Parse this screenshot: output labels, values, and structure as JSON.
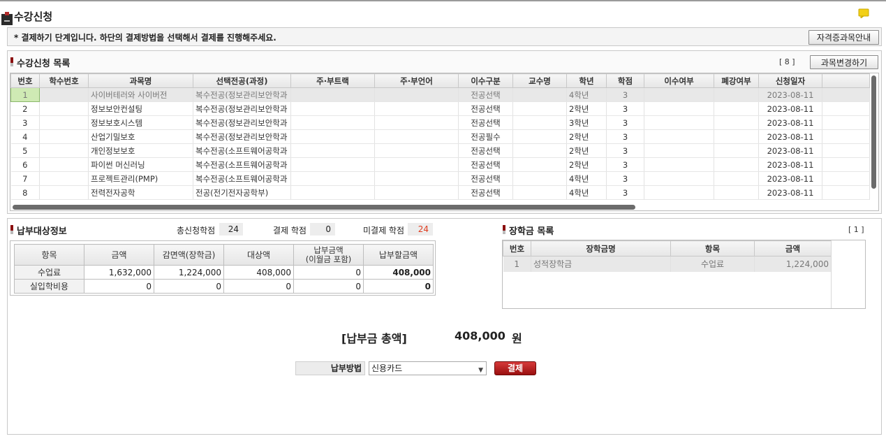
{
  "page": {
    "title": "수강신청",
    "notice": "* 결제하기 단계입니다. 하단의 결제방법을 선택해서 결제를 진행해주세요.",
    "cert_button": "자격증과목안내"
  },
  "course_list": {
    "title": "수강신청 목록",
    "count": "[ 8 ]",
    "change_button": "과목변경하기",
    "columns": [
      "번호",
      "학수번호",
      "과목명",
      "선택전공(과정)",
      "주·부트랙",
      "주·부언어",
      "이수구분",
      "교수명",
      "학년",
      "학점",
      "이수여부",
      "폐강여부",
      "신청일자"
    ],
    "rows": [
      [
        "1",
        "",
        "사이버테러와 사이버전",
        "복수전공(정보관리보안학과",
        "",
        "",
        "전공선택",
        "",
        "4학년",
        "3",
        "",
        "",
        "2023-08-11"
      ],
      [
        "2",
        "",
        "정보보안컨설팅",
        "복수전공(정보관리보안학과",
        "",
        "",
        "전공선택",
        "",
        "2학년",
        "3",
        "",
        "",
        "2023-08-11"
      ],
      [
        "3",
        "",
        "정보보호시스템",
        "복수전공(정보관리보안학과",
        "",
        "",
        "전공선택",
        "",
        "3학년",
        "3",
        "",
        "",
        "2023-08-11"
      ],
      [
        "4",
        "",
        "산업기밀보호",
        "복수전공(정보관리보안학과",
        "",
        "",
        "전공필수",
        "",
        "2학년",
        "3",
        "",
        "",
        "2023-08-11"
      ],
      [
        "5",
        "",
        "개인정보보호",
        "복수전공(소프트웨어공학과",
        "",
        "",
        "전공선택",
        "",
        "2학년",
        "3",
        "",
        "",
        "2023-08-11"
      ],
      [
        "6",
        "",
        "파이썬 머신러닝",
        "복수전공(소프트웨어공학과",
        "",
        "",
        "전공선택",
        "",
        "2학년",
        "3",
        "",
        "",
        "2023-08-11"
      ],
      [
        "7",
        "",
        "프로젝트관리(PMP)",
        "복수전공(소프트웨어공학과",
        "",
        "",
        "전공선택",
        "",
        "4학년",
        "3",
        "",
        "",
        "2023-08-11"
      ],
      [
        "8",
        "",
        "전력전자공학",
        "전공(전기전자공학부)",
        "",
        "",
        "전공선택",
        "",
        "4학년",
        "3",
        "",
        "",
        "2023-08-11"
      ]
    ]
  },
  "payment_info": {
    "title": "납부대상정보",
    "total_credits_label": "총신청학점",
    "total_credits": "24",
    "paid_credits_label": "결제 학점",
    "paid_credits": "0",
    "unpaid_credits_label": "미결제 학점",
    "unpaid_credits": "24",
    "columns": [
      "항목",
      "금액",
      "감면액(장학금)",
      "대상액",
      "납부금액\n(이월금 포함)",
      "납부할금액"
    ],
    "rows": [
      [
        "수업료",
        "1,632,000",
        "1,224,000",
        "408,000",
        "0",
        "408,000"
      ],
      [
        "실입학비용",
        "0",
        "0",
        "0",
        "0",
        "0"
      ]
    ]
  },
  "scholarship": {
    "title": "장학금 목록",
    "count": "[ 1 ]",
    "columns": [
      "번호",
      "장학금명",
      "항목",
      "금액"
    ],
    "rows": [
      [
        "1",
        "성적장학금",
        "수업료",
        "1,224,000"
      ]
    ]
  },
  "total": {
    "label": "[납부금 총액]",
    "amount": "408,000",
    "unit": "원"
  },
  "payment_method": {
    "label": "납부방법",
    "selected": "신용카드",
    "pay_button": "결제"
  },
  "colors": {
    "accent_red": "#9a0f0f",
    "selected_cell": "#cfeab4",
    "unpaid_text": "#e03c1f"
  }
}
